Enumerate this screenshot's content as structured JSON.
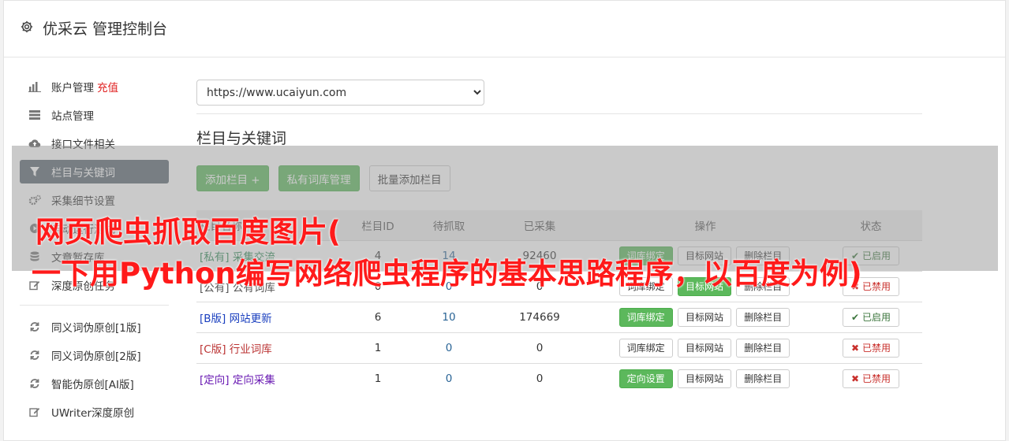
{
  "header": {
    "title": "优采云 管理控制台",
    "icon": "gear-icon"
  },
  "sidebar": {
    "items": [
      {
        "label": "账户管理",
        "badge": "充值",
        "icon": "bar-chart-icon"
      },
      {
        "label": "站点管理",
        "icon": "server-icon"
      },
      {
        "label": "接口文件相关",
        "icon": "cloud-upload-icon"
      },
      {
        "label": "栏目与关键词",
        "icon": "filter-icon",
        "active": true
      },
      {
        "label": "采集细节设置",
        "icon": "cogs-icon"
      },
      {
        "label": "自动运行测试",
        "icon": "play-icon"
      },
      {
        "label": "文章暂存库",
        "icon": "database-icon"
      },
      {
        "label": "深度原创任务",
        "icon": "edit-icon"
      }
    ],
    "items2": [
      {
        "label": "同义词伪原创[1版]",
        "icon": "refresh-icon"
      },
      {
        "label": "同义词伪原创[2版]",
        "icon": "refresh-icon"
      },
      {
        "label": "智能伪原创[AI版]",
        "icon": "refresh-icon"
      },
      {
        "label": "UWriter深度原创",
        "icon": "edit-icon"
      }
    ]
  },
  "main": {
    "site_select": "https://www.ucaiyun.com",
    "section_title": "栏目与关键词",
    "buttons": {
      "add_column": "添加栏目 +",
      "private_lib": "私有词库管理",
      "batch_add": "批量添加栏目"
    }
  },
  "table": {
    "headers": {
      "name": "栏目名称",
      "id": "栏目ID",
      "pending": "待抓取",
      "collected": "已采集",
      "ops": "操作",
      "status": "状态"
    },
    "rows": [
      {
        "tag": "[私有]",
        "name": "采集交流",
        "id": "4",
        "pending": "14",
        "collected": "92460",
        "op1": "词库绑定",
        "op2": "目标网站",
        "op3": "删除栏目",
        "status": "已启用"
      },
      {
        "tag": "[公有]",
        "name": "公有词库",
        "id": "0",
        "pending": "0",
        "collected": "0",
        "op1": "词库绑定",
        "op2": "目标网站",
        "op3": "删除栏目",
        "status": "已禁用"
      },
      {
        "tag": "[B版]",
        "name": "网站更新",
        "id": "6",
        "pending": "10",
        "collected": "174669",
        "op1": "词库绑定",
        "op2": "目标网站",
        "op3": "删除栏目",
        "status": "已启用"
      },
      {
        "tag": "[C版]",
        "name": "行业词库",
        "id": "1",
        "pending": "0",
        "collected": "0",
        "op1": "词库绑定",
        "op2": "目标网站",
        "op3": "删除栏目",
        "status": "已禁用"
      },
      {
        "tag": "[定向]",
        "name": "定向采集",
        "id": "1",
        "pending": "0",
        "collected": "0",
        "op1": "定向设置",
        "op2": "目标网站",
        "op3": "删除栏目",
        "status": "已禁用"
      }
    ]
  },
  "watermark": {
    "line1": "网页爬虫抓取百度图片(",
    "line2": "一下用Python编写网络爬虫程序的基本思路程序，以百度为例)"
  },
  "colors": {
    "active_nav": "#5b6670",
    "green": "#5cb85c",
    "watermark": "#ff1a1a"
  }
}
